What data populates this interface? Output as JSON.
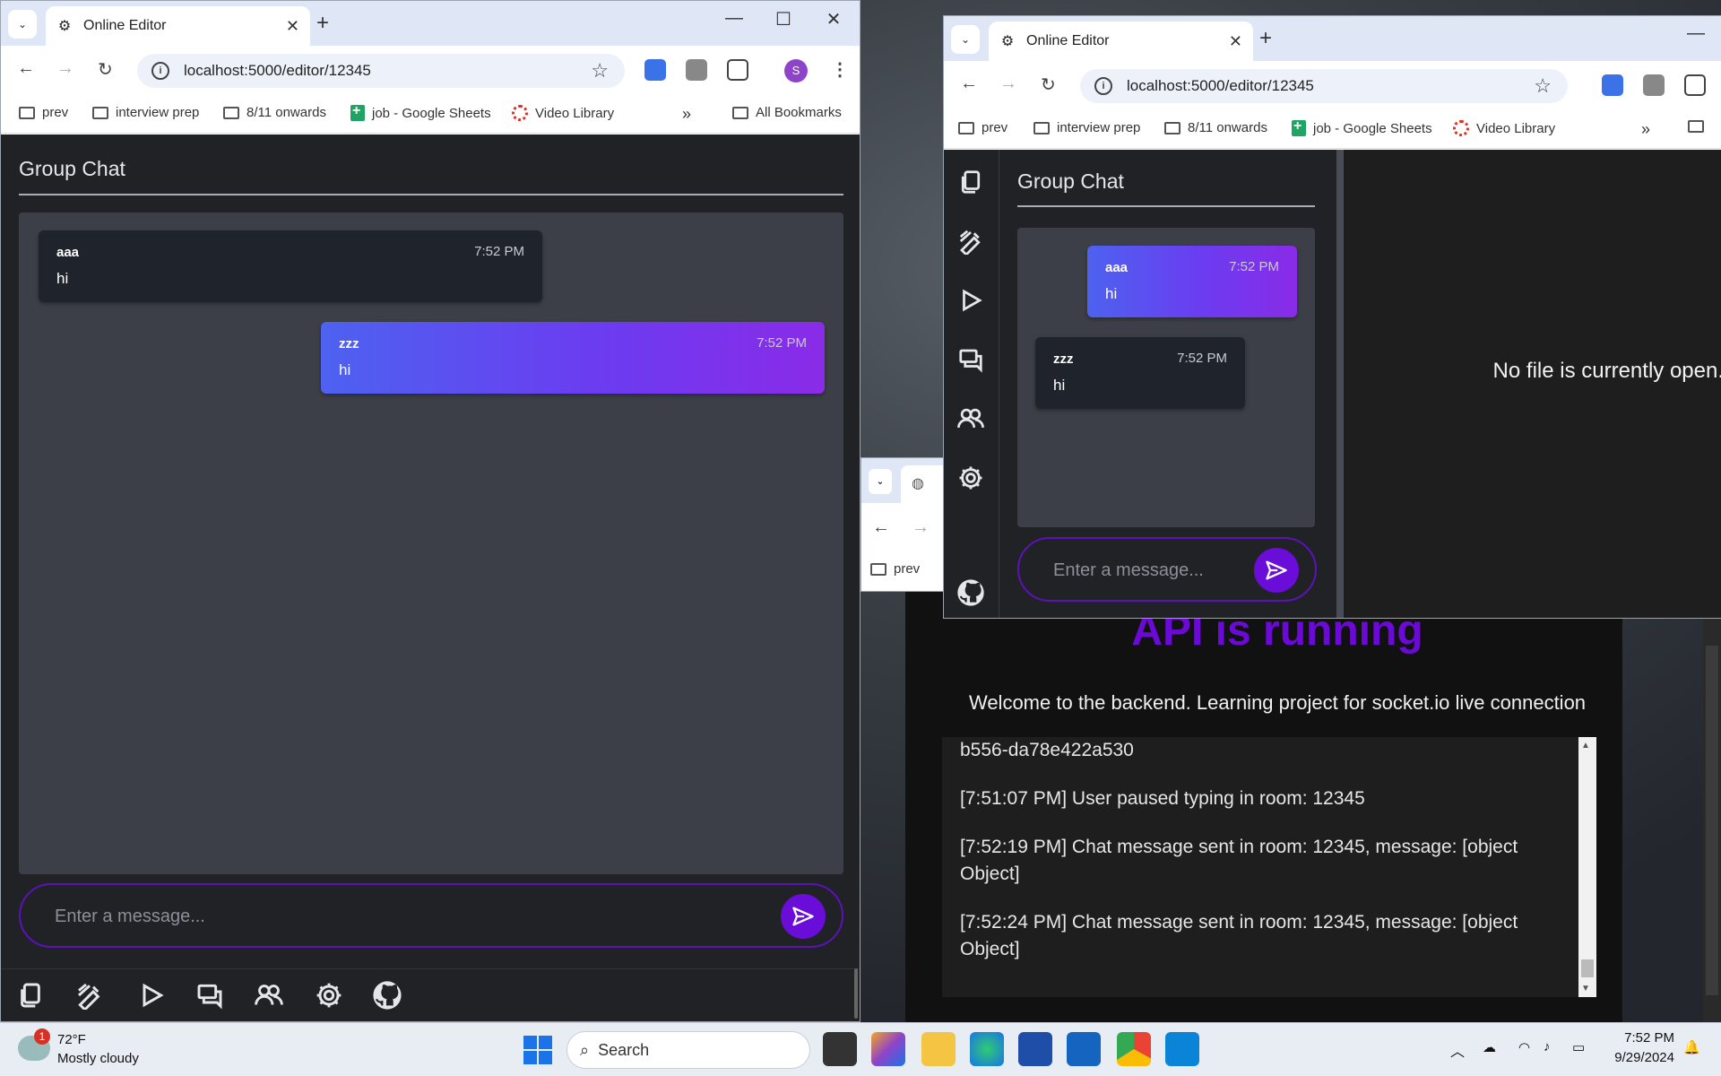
{
  "left_window": {
    "tab_title": "Online Editor",
    "url": "localhost:5000/editor/12345",
    "profile_initial": "S",
    "bookmarks": [
      "prev",
      "interview prep",
      "8/11 onwards",
      "job - Google Sheets",
      "Video Library"
    ],
    "all_bookmarks": "All Bookmarks",
    "chat": {
      "title": "Group Chat",
      "messages": [
        {
          "user": "aaa",
          "time": "7:52 PM",
          "text": "hi"
        },
        {
          "user": "zzz",
          "time": "7:52 PM",
          "text": "hi"
        }
      ],
      "input_placeholder": "Enter a message..."
    }
  },
  "right_window": {
    "tab_title": "Online Editor",
    "url": "localhost:5000/editor/12345",
    "bookmarks": [
      "prev",
      "interview prep",
      "8/11 onwards",
      "job - Google Sheets",
      "Video Library"
    ],
    "chat": {
      "title": "Group Chat",
      "messages": [
        {
          "user": "aaa",
          "time": "7:52 PM",
          "text": "hi"
        },
        {
          "user": "zzz",
          "time": "7:52 PM",
          "text": "hi"
        }
      ],
      "input_placeholder": "Enter a message..."
    },
    "editor_empty": "No file is currently open."
  },
  "behind_window": {
    "bookmark": "prev"
  },
  "backend": {
    "title": "API is running",
    "welcome": "Welcome to the backend. Learning project for socket.io live connection",
    "log": [
      "b556-da78e422a530",
      "[7:51:07 PM] User paused typing in room: 12345",
      "[7:52:19 PM] Chat message sent in room: 12345, message: [object Object]",
      "[7:52:24 PM] Chat message sent in room: 12345, message: [object Object]"
    ]
  },
  "taskbar": {
    "weather_temp": "72°F",
    "weather_desc": "Mostly cloudy",
    "weather_badge": "1",
    "search_label": "Search",
    "time": "7:52 PM",
    "date": "9/29/2024"
  },
  "colors": {
    "accent_purple": "#6a0dd8",
    "gradient_start": "#4d62f0",
    "gradient_end": "#8a2be8",
    "app_bg": "#212226"
  }
}
